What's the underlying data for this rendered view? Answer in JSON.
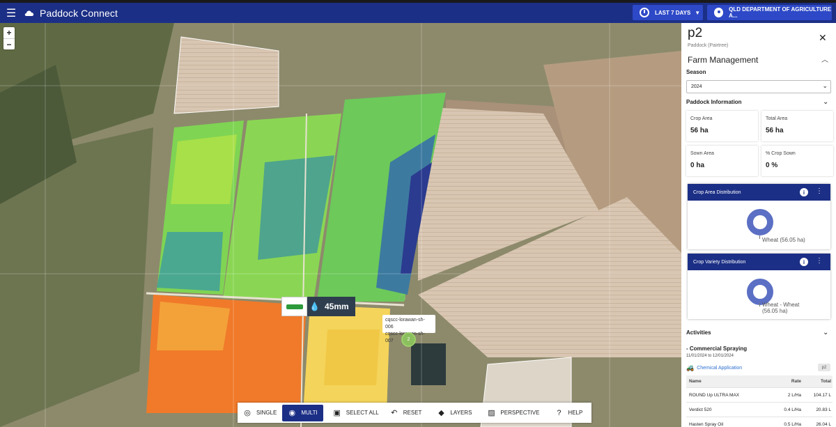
{
  "appbar": {
    "title": "Paddock Connect",
    "time_range_label": "LAST 7 DAYS",
    "organisation_label": "QLD DEPARTMENT OF AGRICULTURE A..."
  },
  "map": {
    "zoom_in": "+",
    "zoom_out": "−",
    "rainfall_value": "45mm",
    "device_tooltip": [
      "cqscc-lorawan-sh-006",
      "cqscc-lorawan-sh-007"
    ],
    "cluster_count": "2"
  },
  "toolbar": {
    "single": "SINGLE",
    "multi": "MULTI",
    "select_all": "SELECT ALL",
    "reset": "RESET",
    "layers": "LAYERS",
    "perspective": "PERSPECTIVE",
    "help": "HELP"
  },
  "panel": {
    "title": "p2",
    "subtitle": "Paddock (Pairtree)",
    "section_title": "Farm Management",
    "season_label": "Season",
    "season_value": "2024",
    "paddock_info_label": "Paddock Information",
    "stats": [
      {
        "label": "Crop Area",
        "value": "56 ha"
      },
      {
        "label": "Total Area",
        "value": "56 ha"
      },
      {
        "label": "Sown Area",
        "value": "0 ha"
      },
      {
        "label": "% Crop Sown",
        "value": "0 %"
      }
    ],
    "crop_area_card": {
      "title": "Crop Area Distribution",
      "slice_label": "Wheat (56.05 ha)"
    },
    "crop_variety_card": {
      "title": "Crop Variety Distribution",
      "slice_label_1": "Wheat - Wheat",
      "slice_label_2": "(56.05 ha)"
    },
    "activities_label": "Activities",
    "activity": {
      "title": "- Commercial Spraying",
      "date": "11/01/2024 to 12/01/2024",
      "type": "Chemical Application",
      "paddock_tag": "p2"
    },
    "table": {
      "headers": [
        "Name",
        "Rate",
        "Total"
      ],
      "rows": [
        [
          "ROUND Up ULTRA MAX",
          "2 L/Ha",
          "104.17 L"
        ],
        [
          "Verdict 520",
          "0.4 L/Ha",
          "20.83 L"
        ],
        [
          "Hasten Spray Oil",
          "0.5 L/Ha",
          "26.04 L"
        ]
      ]
    }
  },
  "colors": {
    "appbar": "#1c2f86",
    "appbar_button": "#2d49c7",
    "accent_link": "#2d6fd0",
    "donut": "#5b6fc4"
  }
}
